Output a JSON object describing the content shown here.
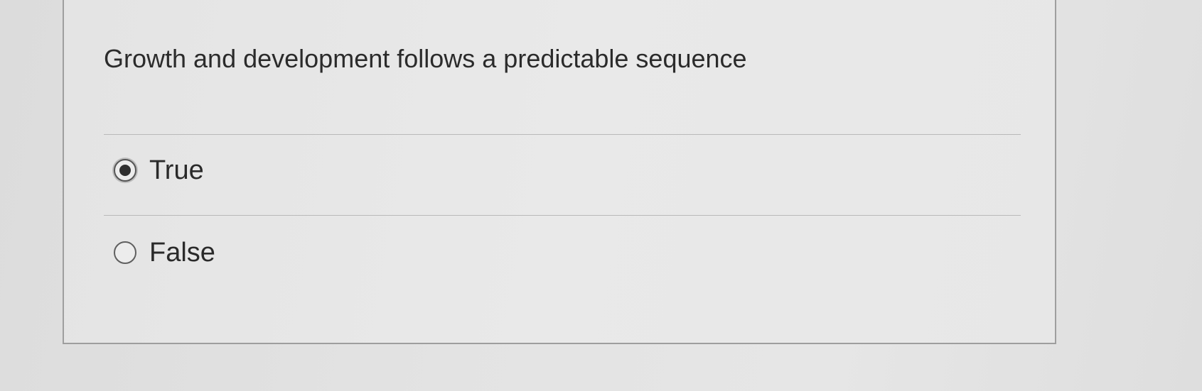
{
  "question": {
    "text": "Growth and development follows a predictable sequence"
  },
  "options": [
    {
      "label": "True",
      "selected": true
    },
    {
      "label": "False",
      "selected": false
    }
  ],
  "colors": {
    "background": "#e2e2e2",
    "card_border": "#9e9e9e",
    "text": "#2b2b2b",
    "divider": "#b9b9b9"
  }
}
